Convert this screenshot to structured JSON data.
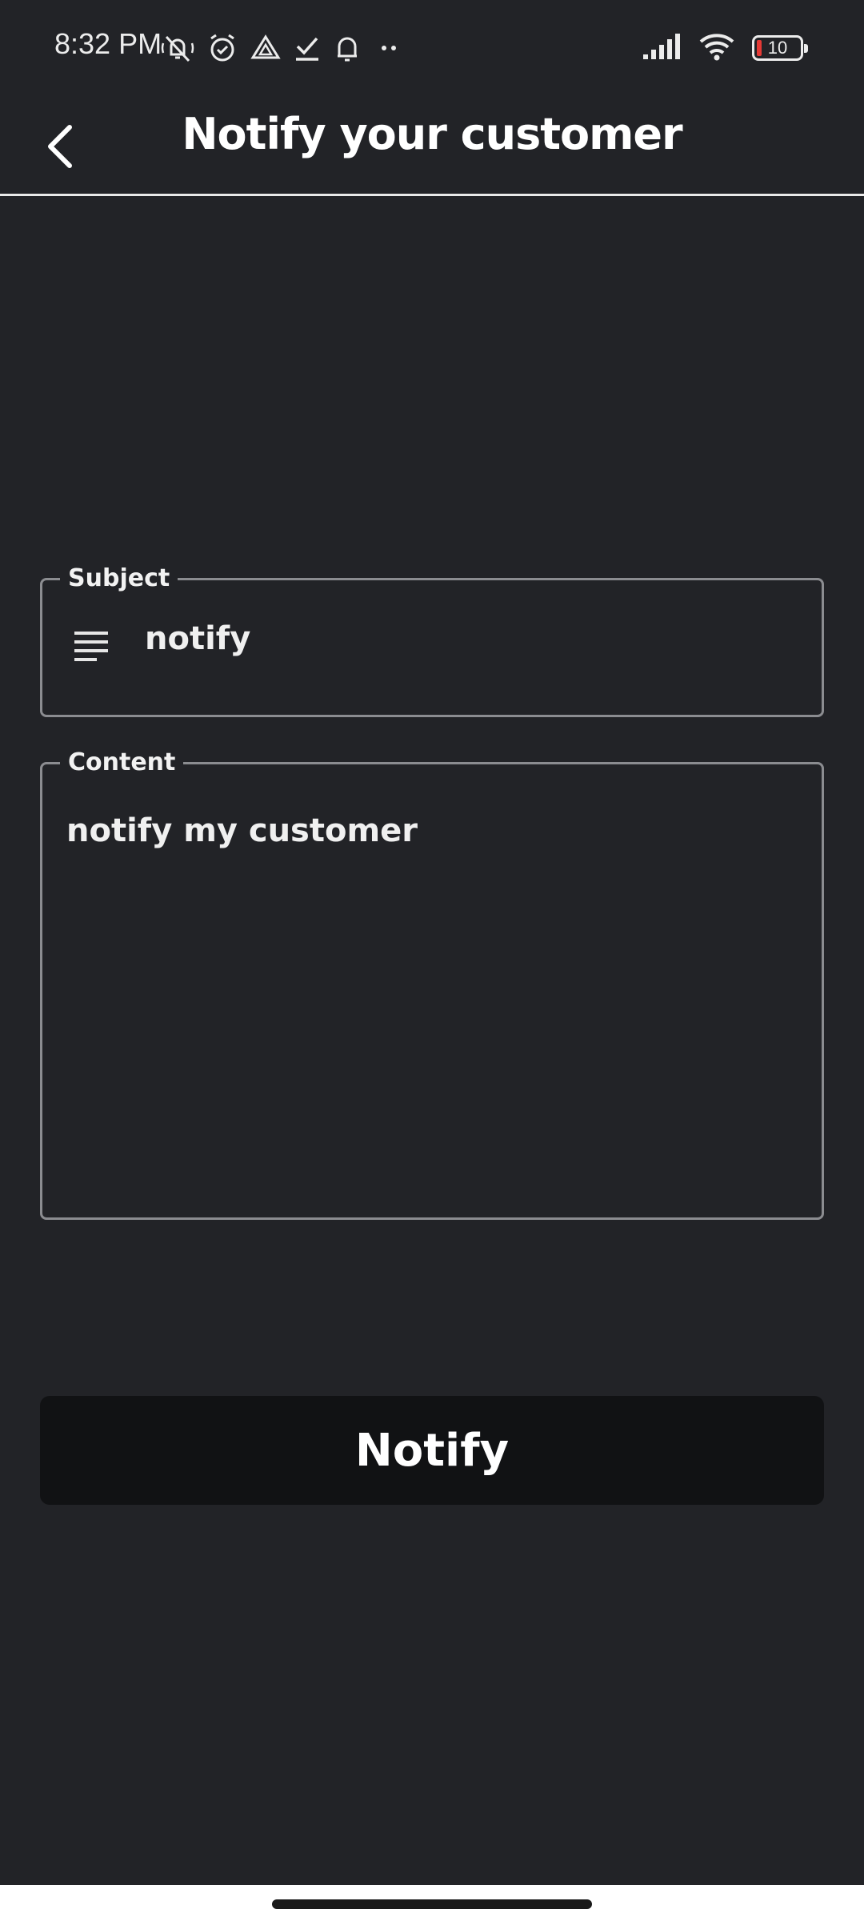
{
  "status_bar": {
    "time": "8:32 PM",
    "battery_level": "10",
    "icons_left": [
      "muted-bell-icon",
      "alarm-icon",
      "drive-icon",
      "check-icon",
      "notification-bell-icon",
      "more-dots-icon"
    ],
    "icons_right": [
      "signal-icon",
      "wifi-icon",
      "battery-icon"
    ],
    "battery_color": "#e53935"
  },
  "app_bar": {
    "title": "Notify your customer",
    "back_icon": "chevron-left-icon"
  },
  "form": {
    "subject": {
      "label": "Subject",
      "value": "notify",
      "icon": "text-lines-icon"
    },
    "content": {
      "label": "Content",
      "value": "notify my customer"
    }
  },
  "actions": {
    "notify_label": "Notify"
  },
  "colors": {
    "background": "#222327",
    "button": "#111214",
    "field_border": "#8b8c90",
    "text": "#ffffff"
  }
}
